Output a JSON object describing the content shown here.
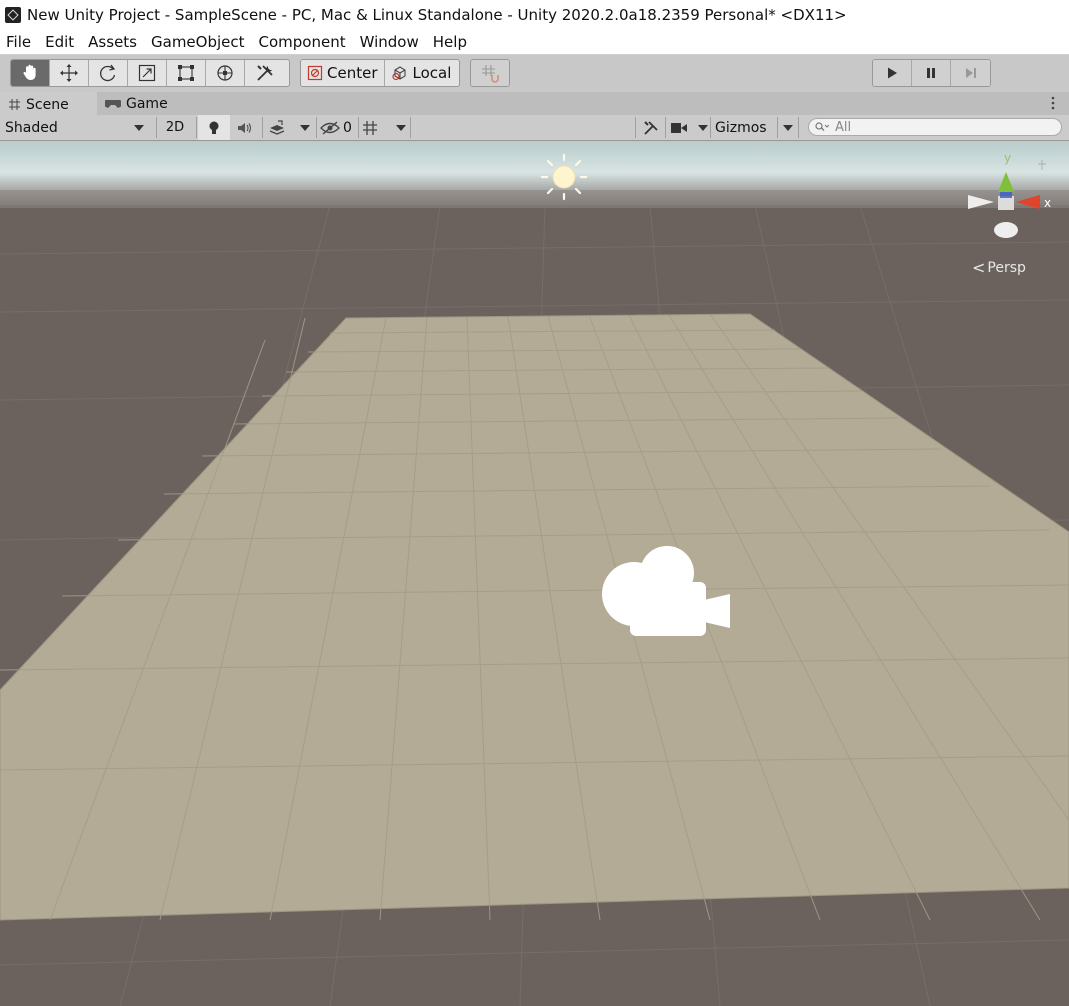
{
  "window": {
    "title": "New Unity Project - SampleScene - PC, Mac & Linux Standalone - Unity 2020.2.0a18.2359 Personal* <DX11>"
  },
  "menu": [
    "File",
    "Edit",
    "Assets",
    "GameObject",
    "Component",
    "Window",
    "Help"
  ],
  "toolbar": {
    "tools": [
      "hand-tool-icon",
      "move-tool-icon",
      "rotate-tool-icon",
      "scale-tool-icon",
      "rect-tool-icon",
      "transform-tool-icon",
      "custom-tool-icon"
    ],
    "pivot_label": "Center",
    "rotation_label": "Local",
    "play_icons": [
      "play-icon",
      "pause-icon",
      "step-icon"
    ]
  },
  "tabs": {
    "scene": "Scene",
    "game": "Game"
  },
  "scene_toolbar": {
    "draw_mode": "Shaded",
    "mode_2d": "2D",
    "hidden_count": "0",
    "gizmos": "Gizmos",
    "search_placeholder": "All"
  },
  "viewport": {
    "persp_label": "Persp",
    "axis_y": "y",
    "axis_x": "x"
  },
  "colors": {
    "sky_top": "#c9dcdc",
    "ground": "#6b625d",
    "plane": "#b3ab95",
    "axis_x": "#e0442a",
    "axis_y": "#7ec03a"
  }
}
